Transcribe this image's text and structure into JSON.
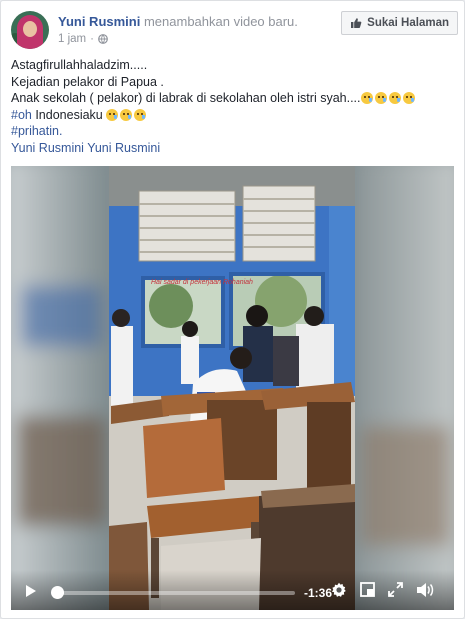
{
  "post": {
    "author": "Yuni Rusmini",
    "action": "menambahkan video baru.",
    "time": "1 jam",
    "dot": "·",
    "privacy_icon": "globe-icon",
    "like_page_label": "Sukai Halaman",
    "like_icon": "thumbs-up-icon"
  },
  "text": {
    "line1": "Astagfirullahhaladzim.....",
    "line2": "Kejadian pelakor di Papua .",
    "line3": "Anak sekolah ( pelakor) di labrak di sekolahan oleh istri syah....",
    "line3_emoji_count": 4,
    "line4_tag": "#oh",
    "line4_text": " Indonesiaku ",
    "line4_emoji_count": 3,
    "line5_tag": "#prihatin.",
    "line6_mentions": "Yuni Rusmini Yuni Rusmini"
  },
  "video": {
    "remaining_time": "-1:36",
    "progress_fraction": 0.03,
    "icons": [
      "play-icon",
      "settings-icon",
      "pip-icon",
      "fullscreen-icon",
      "volume-icon"
    ],
    "wall_text": "Hai sadar di pekerjaan Rohaniah",
    "colors": {
      "wall": "#3d74c4",
      "desk": "#b46b3a",
      "floor": "#d9d4cc"
    }
  }
}
